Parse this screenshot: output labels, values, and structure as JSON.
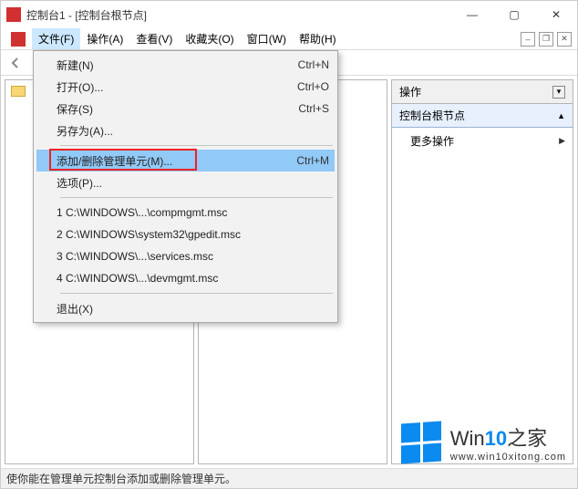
{
  "title": "控制台1 - [控制台根节点]",
  "menubar": {
    "file": "文件(F)",
    "action": "操作(A)",
    "view": "查看(V)",
    "favorites": "收藏夹(O)",
    "window": "窗口(W)",
    "help": "帮助(H)"
  },
  "dropdown": {
    "new": "新建(N)",
    "new_sc": "Ctrl+N",
    "open": "打开(O)...",
    "open_sc": "Ctrl+O",
    "save": "保存(S)",
    "save_sc": "Ctrl+S",
    "saveas": "另存为(A)...",
    "addremove": "添加/删除管理单元(M)...",
    "addremove_sc": "Ctrl+M",
    "options": "选项(P)...",
    "recent1": "1 C:\\WINDOWS\\...\\compmgmt.msc",
    "recent2": "2 C:\\WINDOWS\\system32\\gpedit.msc",
    "recent3": "3 C:\\WINDOWS\\...\\services.msc",
    "recent4": "4 C:\\WINDOWS\\...\\devmgmt.msc",
    "exit": "退出(X)"
  },
  "actions": {
    "header": "操作",
    "section": "控制台根节点",
    "more": "更多操作"
  },
  "status": "使你能在管理单元控制台添加或删除管理单元。",
  "watermark": {
    "brand_prefix": "Win",
    "brand_accent": "10",
    "brand_suffix": "之家",
    "url": "www.win10xitong.com"
  }
}
